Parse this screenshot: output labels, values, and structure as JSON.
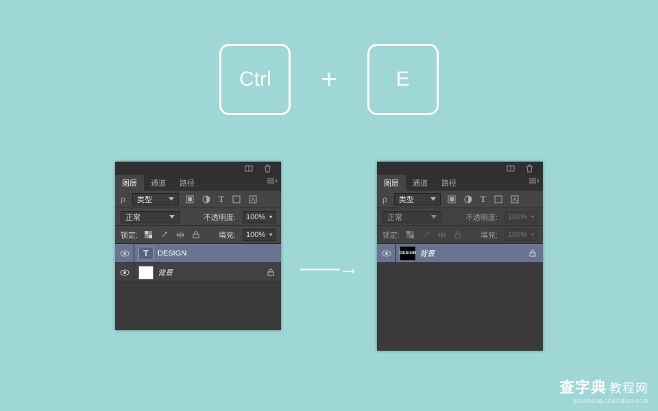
{
  "shortcut": {
    "key1": "Ctrl",
    "plus": "+",
    "key2": "E"
  },
  "arrow": "——→",
  "panel_common": {
    "tabs": {
      "layers": "图层",
      "channels": "通道",
      "paths": "路径"
    },
    "kind_label": "类型",
    "blend_normal": "正常",
    "opacity_label": "不透明度:",
    "lock_label": "锁定:",
    "fill_label": "填充:",
    "val_100": "100%"
  },
  "panel_left": {
    "layer_design": "DESIGN",
    "layer_bg": "背景"
  },
  "panel_right": {
    "layer_result": "背景",
    "thumb_text": "DESIGN"
  },
  "watermark": {
    "main1": "查字典",
    "main2": "教程网",
    "url": "jiaocheng.chazidian.com"
  }
}
